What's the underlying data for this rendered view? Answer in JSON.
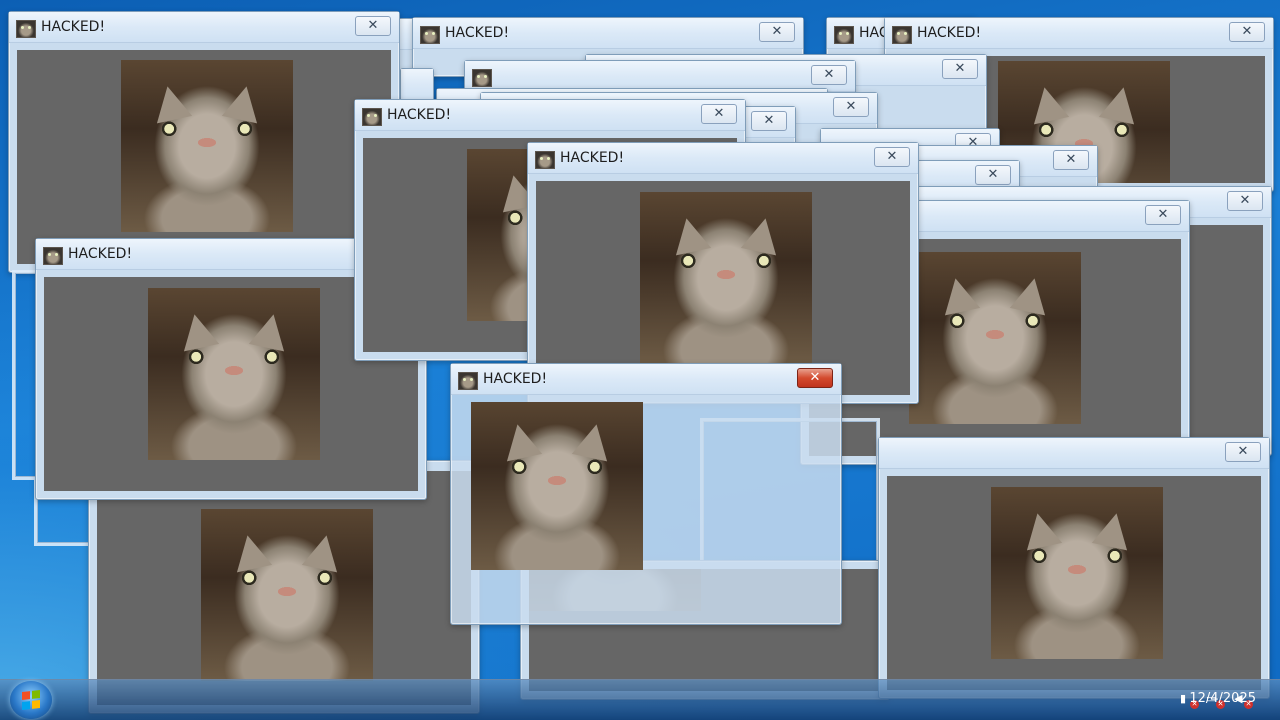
{
  "window_title": "HACKED!",
  "close_glyph": "✕",
  "active_close_glyph": "✕",
  "icons": {
    "title_icon": "cat-thumbnail-icon",
    "close": "close-icon",
    "start": "windows-start-orb-icon",
    "tray_network": "network-error-icon",
    "tray_power": "power-error-icon",
    "tray_volume": "volume-error-icon"
  },
  "client_background": "#666666",
  "taskbar": {
    "date": "12/4/2025"
  }
}
